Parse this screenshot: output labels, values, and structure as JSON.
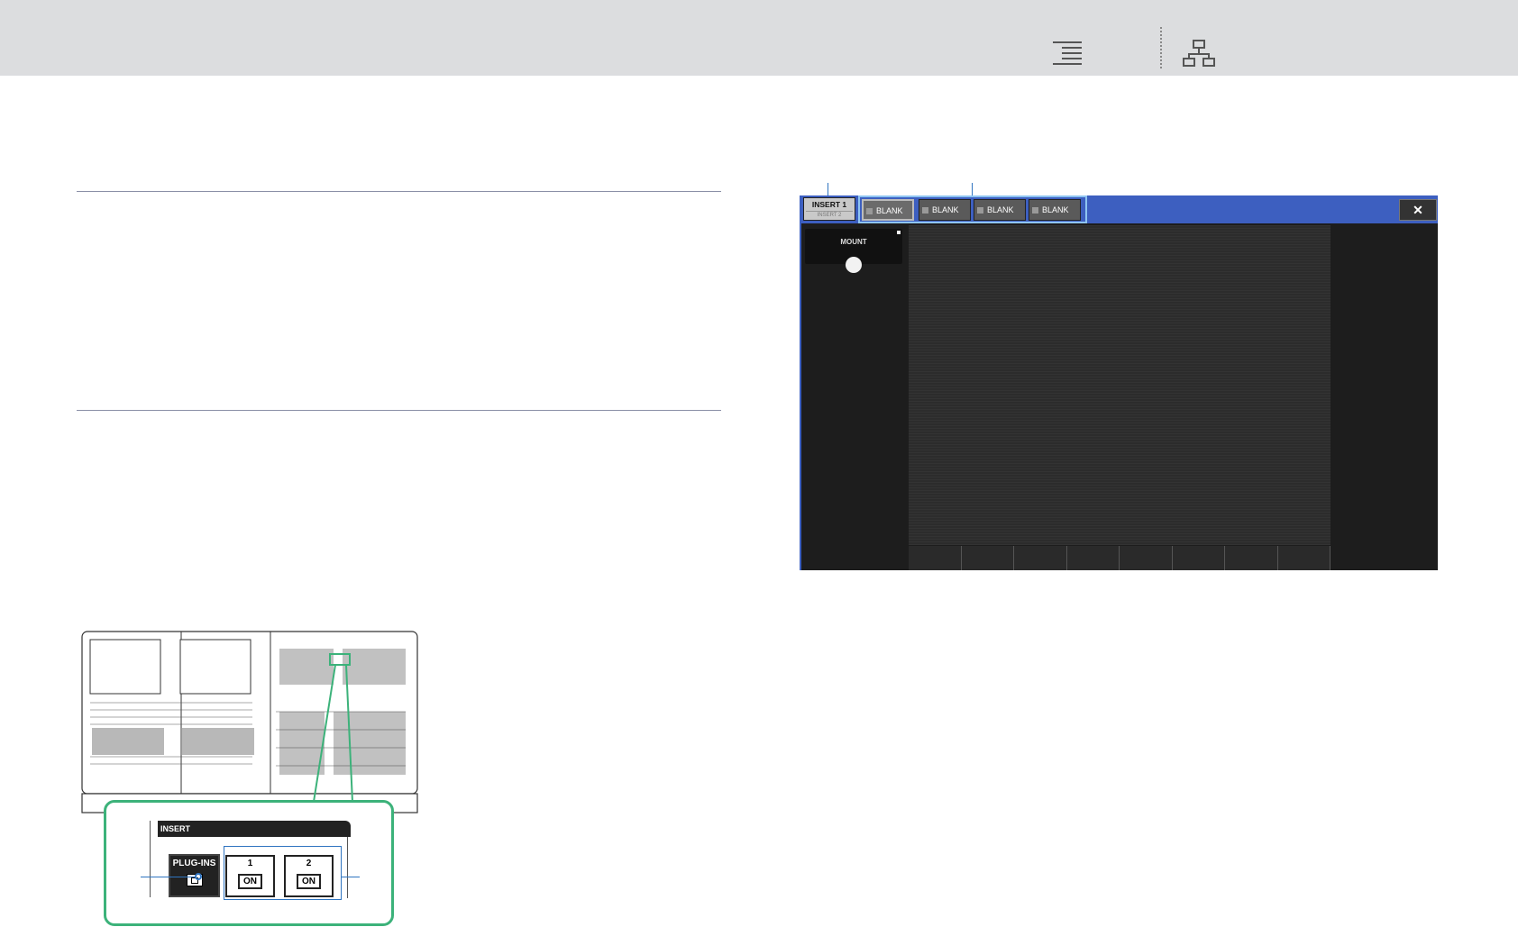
{
  "header": {
    "toc_icon": "table-of-contents-icon",
    "sitemap_icon": "sitemap-icon"
  },
  "console_callout": {
    "insert_label": "INSERT",
    "plug_ins_label": "PLUG-INS",
    "buttons": [
      {
        "number": "1",
        "on_label": "ON"
      },
      {
        "number": "2",
        "on_label": "ON"
      }
    ]
  },
  "plugin_screen": {
    "insert_tab": {
      "active": "INSERT 1",
      "inactive": "INSERT 2"
    },
    "slots": [
      "BLANK",
      "BLANK",
      "BLANK",
      "BLANK"
    ],
    "close_label": "✕",
    "mount_label": "MOUNT",
    "soft_key_count": 8
  },
  "colors": {
    "accent_green": "#3cb27a",
    "callout_blue": "#2f74c0",
    "screen_blue": "#3d5fc0"
  }
}
